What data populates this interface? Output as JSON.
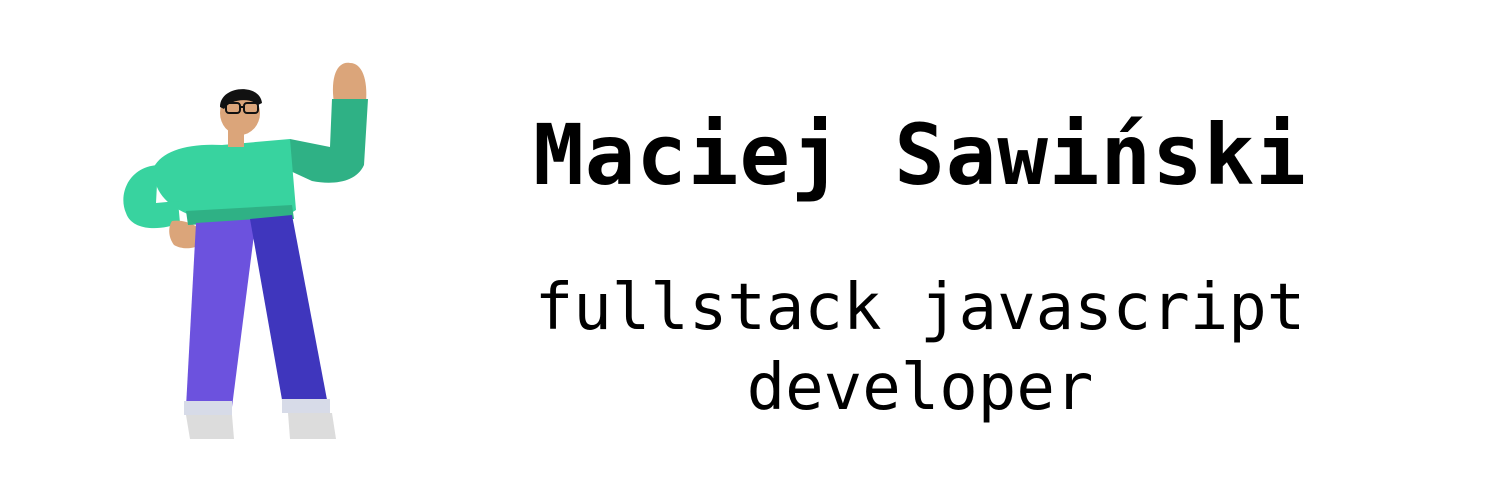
{
  "profile": {
    "name": "Maciej Sawiński",
    "role_line_1": "fullstack javascript",
    "role_line_2": "developer"
  },
  "colors": {
    "background": "#ffffff",
    "text": "#000000",
    "sweater": "#38d39f",
    "sweater_shadow": "#2fb185",
    "pants_light": "#6c52de",
    "pants_dark": "#3f36bd",
    "skin": "#dba57a",
    "hair": "#111111",
    "shoe": "#dcdcdc"
  },
  "icons": {
    "illustration": "waving-developer-illustration"
  }
}
